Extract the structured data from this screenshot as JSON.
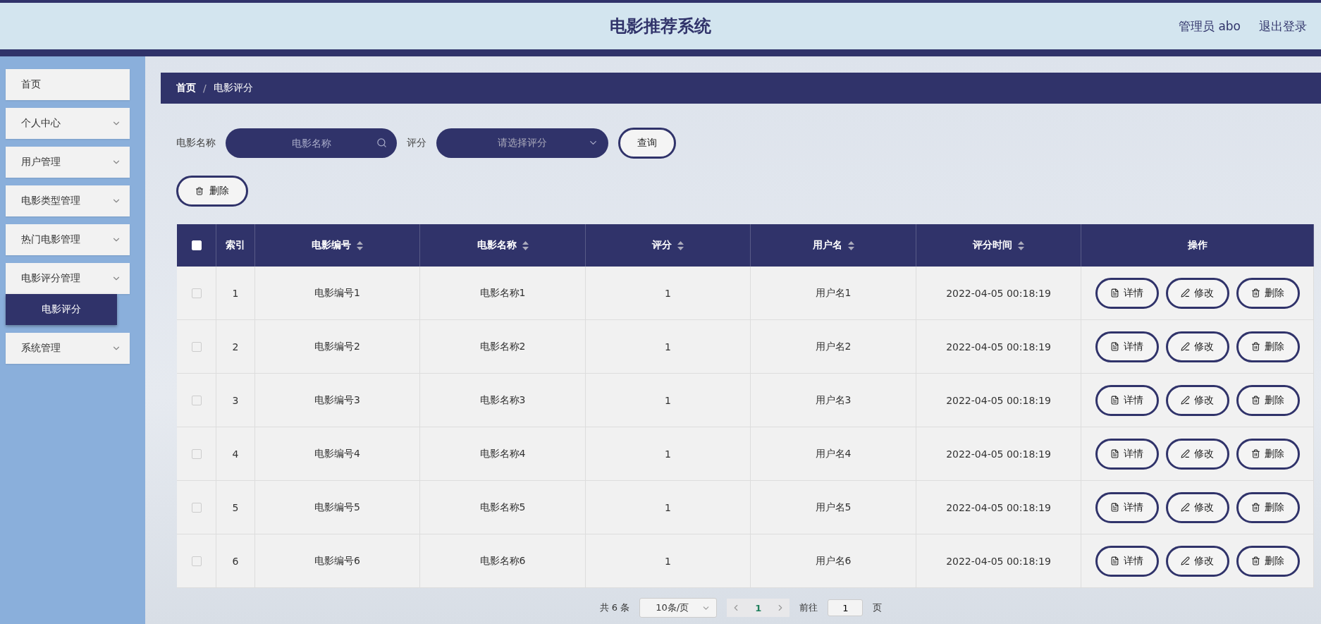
{
  "header": {
    "title": "电影推荐系统",
    "user": "管理员 abo",
    "logout": "退出登录"
  },
  "sidebar": {
    "items": [
      {
        "label": "首页",
        "expandable": false
      },
      {
        "label": "个人中心",
        "expandable": true,
        "expanded": false
      },
      {
        "label": "用户管理",
        "expandable": true,
        "expanded": false
      },
      {
        "label": "电影类型管理",
        "expandable": true,
        "expanded": false
      },
      {
        "label": "热门电影管理",
        "expandable": true,
        "expanded": false
      },
      {
        "label": "电影评分管理",
        "expandable": true,
        "expanded": true,
        "children": [
          {
            "label": "电影评分",
            "selected": true
          }
        ]
      },
      {
        "label": "系统管理",
        "expandable": true,
        "expanded": false
      }
    ]
  },
  "breadcrumb": [
    "首页",
    "电影评分"
  ],
  "breadcrumb_separator": "/",
  "search": {
    "name_label": "电影名称",
    "name_placeholder": "电影名称",
    "score_label": "评分",
    "score_placeholder": "请选择评分",
    "query_button": "查询"
  },
  "delete_button": "删除",
  "table": {
    "all_checked": false,
    "columns": [
      {
        "label": "索引",
        "sortable": false
      },
      {
        "label": "电影编号",
        "sortable": true
      },
      {
        "label": "电影名称",
        "sortable": true
      },
      {
        "label": "评分",
        "sortable": true
      },
      {
        "label": "用户名",
        "sortable": true
      },
      {
        "label": "评分时间",
        "sortable": true
      },
      {
        "label": "操作",
        "sortable": false
      }
    ],
    "rows": [
      {
        "checked": false,
        "cells": [
          "1",
          "电影编号1",
          "电影名称1",
          "1",
          "用户名1",
          "2022-04-05 00:18:19"
        ],
        "actions": [
          {
            "kind": "detail",
            "label": "详情"
          },
          {
            "kind": "edit",
            "label": "修改"
          },
          {
            "kind": "delete",
            "label": "删除"
          }
        ]
      },
      {
        "checked": false,
        "cells": [
          "2",
          "电影编号2",
          "电影名称2",
          "1",
          "用户名2",
          "2022-04-05 00:18:19"
        ],
        "actions": [
          {
            "kind": "detail",
            "label": "详情"
          },
          {
            "kind": "edit",
            "label": "修改"
          },
          {
            "kind": "delete",
            "label": "删除"
          }
        ]
      },
      {
        "checked": false,
        "cells": [
          "3",
          "电影编号3",
          "电影名称3",
          "1",
          "用户名3",
          "2022-04-05 00:18:19"
        ],
        "actions": [
          {
            "kind": "detail",
            "label": "详情"
          },
          {
            "kind": "edit",
            "label": "修改"
          },
          {
            "kind": "delete",
            "label": "删除"
          }
        ]
      },
      {
        "checked": false,
        "cells": [
          "4",
          "电影编号4",
          "电影名称4",
          "1",
          "用户名4",
          "2022-04-05 00:18:19"
        ],
        "actions": [
          {
            "kind": "detail",
            "label": "详情"
          },
          {
            "kind": "edit",
            "label": "修改"
          },
          {
            "kind": "delete",
            "label": "删除"
          }
        ]
      },
      {
        "checked": false,
        "cells": [
          "5",
          "电影编号5",
          "电影名称5",
          "1",
          "用户名5",
          "2022-04-05 00:18:19"
        ],
        "actions": [
          {
            "kind": "detail",
            "label": "详情"
          },
          {
            "kind": "edit",
            "label": "修改"
          },
          {
            "kind": "delete",
            "label": "删除"
          }
        ]
      },
      {
        "checked": false,
        "cells": [
          "6",
          "电影编号6",
          "电影名称6",
          "1",
          "用户名6",
          "2022-04-05 00:18:19"
        ],
        "actions": [
          {
            "kind": "detail",
            "label": "详情"
          },
          {
            "kind": "edit",
            "label": "修改"
          },
          {
            "kind": "delete",
            "label": "删除"
          }
        ]
      }
    ]
  },
  "pagination": {
    "total": "共 6 条",
    "page_size": "10条/页",
    "pages": [
      {
        "label": "1",
        "selected": true
      }
    ],
    "goto_label": "前往",
    "goto_value": "1",
    "goto_suffix": "页"
  }
}
